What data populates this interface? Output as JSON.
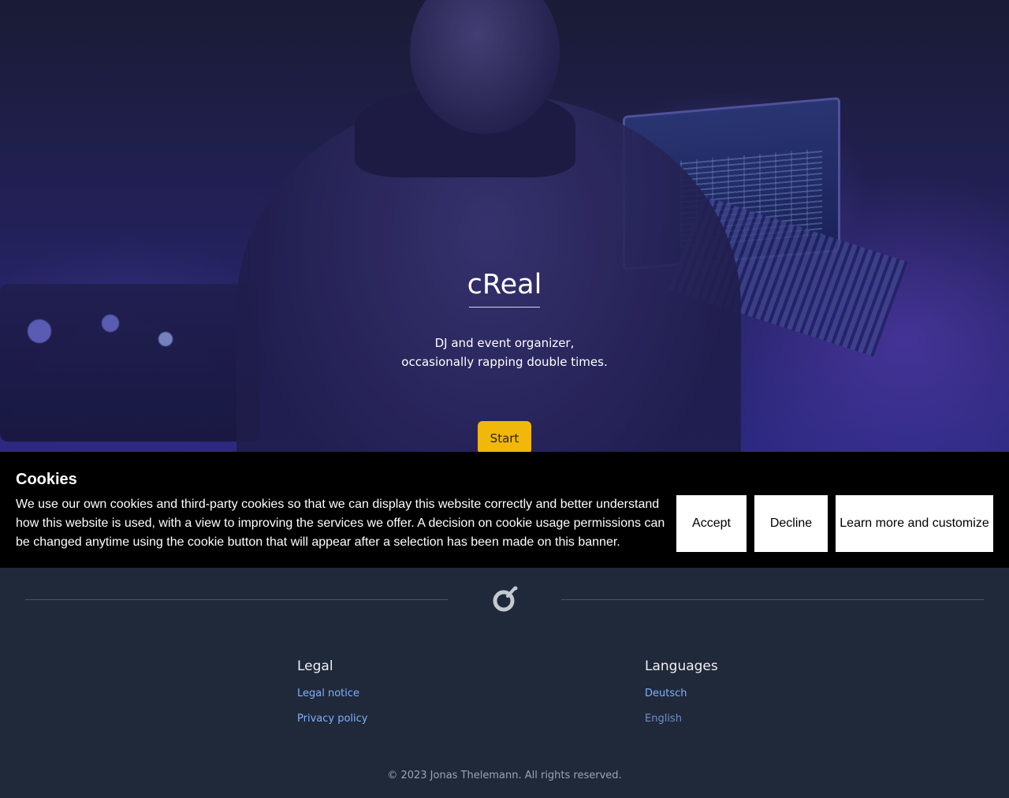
{
  "hero": {
    "title": "cReal",
    "subtitle_line1": "DJ and event organizer,",
    "subtitle_line2": "occasionally rapping double times.",
    "start_label": "Start",
    "accent_color": "#f1b70a"
  },
  "cookie_banner": {
    "title": "Cookies",
    "text": "We use our own cookies and third-party cookies so that we can display this website correctly and better understand how this website is used, with a view to improving the services we offer. A decision on cookie usage permissions can be changed anytime using the cookie button that will appear after a selection has been made on this banner.",
    "accept_label": "Accept",
    "decline_label": "Decline",
    "learn_more_label": "Learn more and customize"
  },
  "footer": {
    "logo_icon": "logo-icon",
    "legal": {
      "heading": "Legal",
      "links": [
        "Legal notice",
        "Privacy policy"
      ]
    },
    "languages": {
      "heading": "Languages",
      "links": [
        "Deutsch",
        "English"
      ],
      "current": "English"
    },
    "copyright": "© 2023 Jonas Thelemann. All rights reserved."
  }
}
